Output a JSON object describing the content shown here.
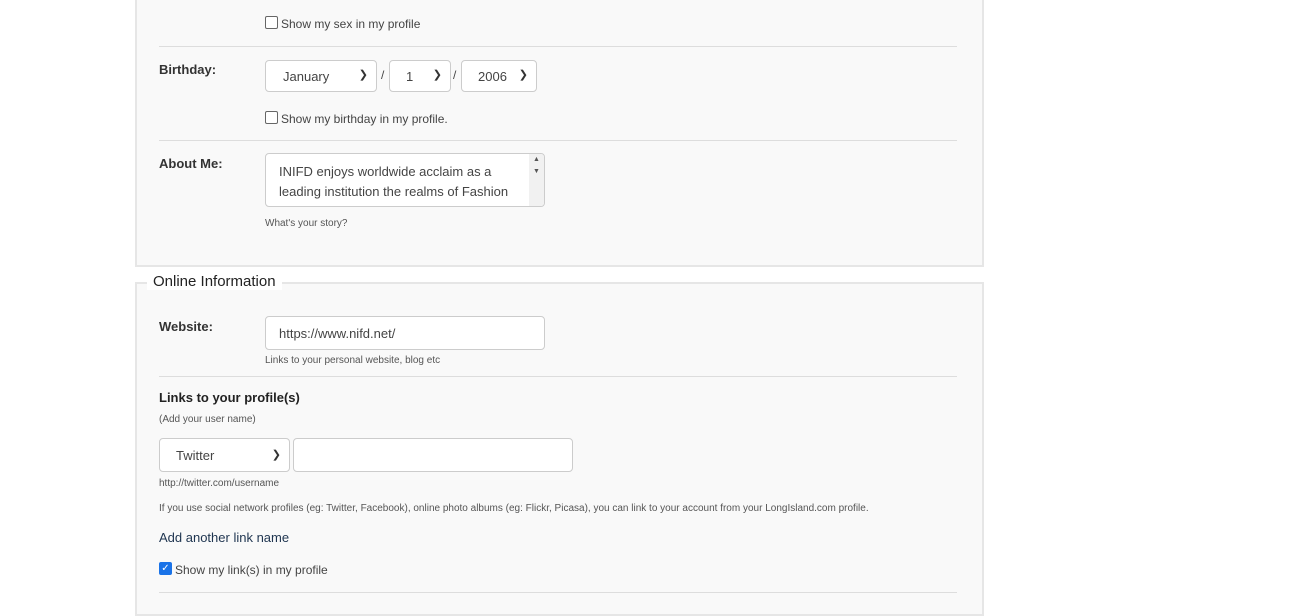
{
  "profile": {
    "show_sex_label": "Show my sex in my profile",
    "birthday_label": "Birthday:",
    "birthday_month": "January",
    "birthday_day": "1",
    "birthday_year": "2006",
    "separator": "/",
    "show_birthday_label": "Show my birthday in my profile.",
    "about_label": "About Me:",
    "about_value": "INIFD enjoys worldwide acclaim as a leading institution the realms of Fashion and Interior Design. With a legacy of",
    "about_help": "What's your story?"
  },
  "online": {
    "legend": "Online Information",
    "website_label": "Website:",
    "website_value": "https://www.nifd.net/",
    "website_help": "Links to your personal website, blog etc",
    "links_title": "Links to your profile(s)",
    "links_sub": "(Add your user name)",
    "network_selected": "Twitter",
    "username_value": "",
    "network_help": "http://twitter.com/username",
    "info": "If you use social network profiles (eg: Twitter, Facebook), online photo albums (eg: Flickr, Picasa), you can link to your account from your LongIsland.com profile.",
    "add_link": "Add another link name",
    "show_links_label": "Show my link(s) in my profile",
    "show_links_checked": true
  }
}
